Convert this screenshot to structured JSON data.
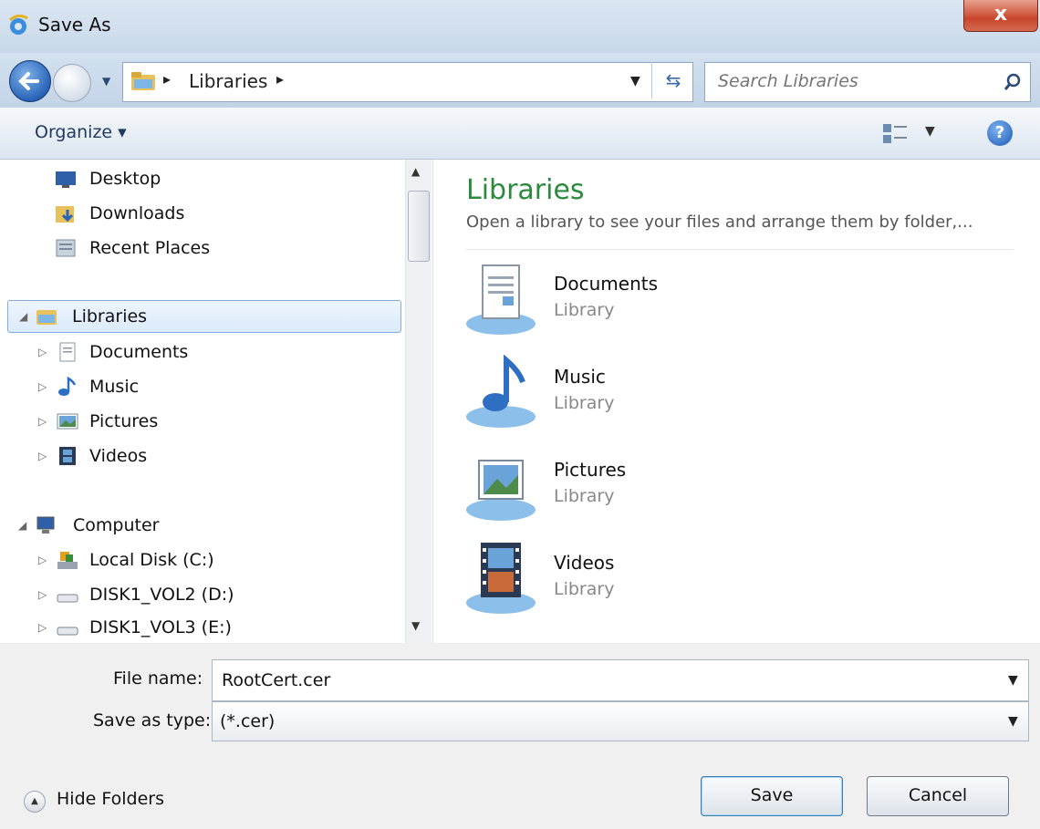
{
  "window": {
    "title": "Save As",
    "close_label": "x"
  },
  "nav": {
    "address_segment": "Libraries",
    "search_placeholder": "Search Libraries"
  },
  "toolbar": {
    "organize_label": "Organize ▾",
    "help_label": "?"
  },
  "tree": {
    "favorites": [
      "Desktop",
      "Downloads",
      "Recent Places"
    ],
    "libraries_label": "Libraries",
    "libraries": [
      "Documents",
      "Music",
      "Pictures",
      "Videos"
    ],
    "computer_label": "Computer",
    "drives": [
      "Local Disk (C:)",
      "DISK1_VOL2 (D:)",
      "DISK1_VOL3 (E:)"
    ]
  },
  "content": {
    "title": "Libraries",
    "subtitle": "Open a library to see your files and arrange them by folder,...",
    "items": [
      {
        "name": "Documents",
        "kind": "Library"
      },
      {
        "name": "Music",
        "kind": "Library"
      },
      {
        "name": "Pictures",
        "kind": "Library"
      },
      {
        "name": "Videos",
        "kind": "Library"
      }
    ]
  },
  "form": {
    "file_name_label": "File name:",
    "file_name_value": "RootCert.cer",
    "save_type_label": "Save as type:",
    "save_type_value": "(*.cer)"
  },
  "footer": {
    "hide_folders_label": "Hide Folders",
    "save_label": "Save",
    "cancel_label": "Cancel"
  },
  "colors": {
    "library_title": "#2b8a3e",
    "accent": "#2a64b8",
    "close": "#c9472b"
  }
}
